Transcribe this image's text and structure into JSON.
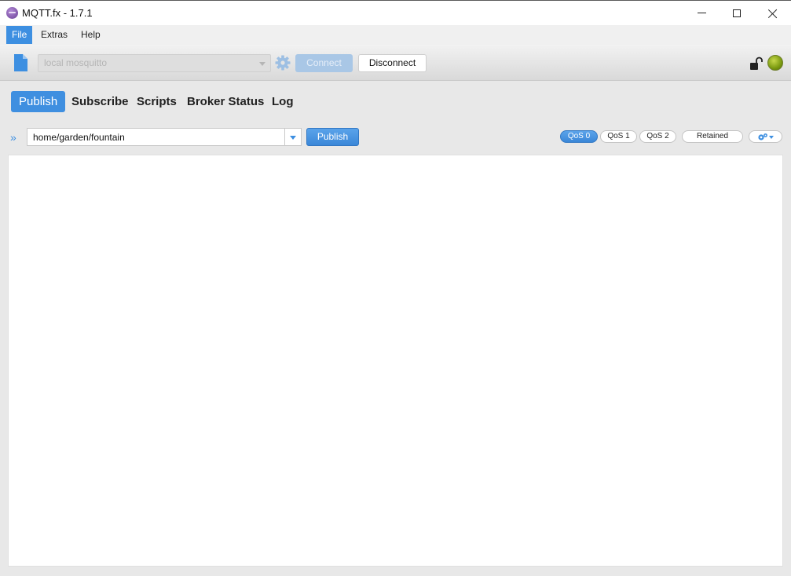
{
  "window": {
    "title": "MQTT.fx - 1.7.1"
  },
  "menu": {
    "items": [
      "File",
      "Extras",
      "Help"
    ]
  },
  "connection": {
    "profile": "local mosquitto",
    "connect_label": "Connect",
    "disconnect_label": "Disconnect",
    "status_color": "#8fb21c"
  },
  "tabs": [
    "Publish",
    "Subscribe",
    "Scripts",
    "Broker Status",
    "Log"
  ],
  "publish": {
    "topic": "home/garden/fountain",
    "publish_label": "Publish",
    "qos": [
      "QoS 0",
      "QoS 1",
      "QoS 2"
    ],
    "selected_qos": "QoS 0",
    "retained_label": "Retained",
    "payload": ""
  },
  "colors": {
    "accent": "#3d8fe1"
  }
}
